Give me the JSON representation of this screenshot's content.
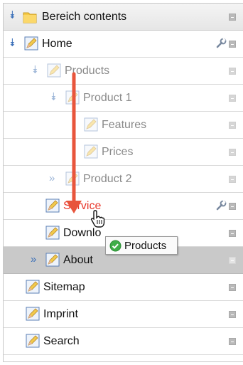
{
  "tree": {
    "header_label": "Bereich contents",
    "rows": [
      {
        "label": "Home"
      },
      {
        "label": "Products"
      },
      {
        "label": "Product 1"
      },
      {
        "label": "Features"
      },
      {
        "label": "Prices"
      },
      {
        "label": "Product 2"
      },
      {
        "label": "Service"
      },
      {
        "label": "Downlo"
      },
      {
        "label": "About"
      },
      {
        "label": "Sitemap"
      },
      {
        "label": "Imprint"
      },
      {
        "label": "Search"
      }
    ]
  },
  "drag": {
    "tooltip_label": "Products",
    "arrow_color": "#e8553c"
  },
  "colors": {
    "active_text": "#e8382c",
    "selected_row": "#c9c9c9",
    "chevron": "#3a6fb8"
  }
}
